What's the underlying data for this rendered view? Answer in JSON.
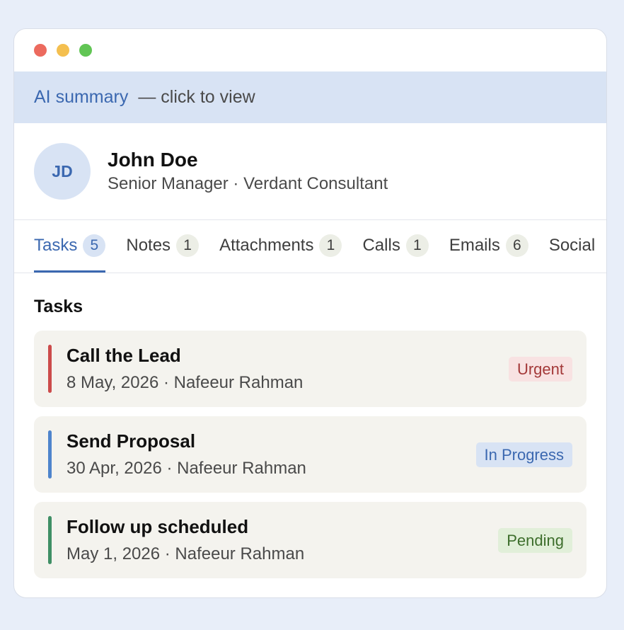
{
  "ai_summary": {
    "link": "AI summary",
    "hint": "— click to view"
  },
  "profile": {
    "initials": "JD",
    "name": "John Doe",
    "role": "Senior Manager · Verdant Consultant"
  },
  "tabs": [
    {
      "label": "Tasks",
      "count": "5",
      "active": true
    },
    {
      "label": "Notes",
      "count": "1"
    },
    {
      "label": "Attachments",
      "count": "1"
    },
    {
      "label": "Calls",
      "count": "1"
    },
    {
      "label": "Emails",
      "count": "6"
    },
    {
      "label": "Social",
      "count": ""
    }
  ],
  "section_title": "Tasks",
  "tasks": [
    {
      "title": "Call the Lead",
      "meta": "8 May, 2026 · Nafeeur Rahman",
      "status": "Urgent",
      "stripe_color": "#cc4b4b",
      "badge_bg": "#f8e2e2",
      "badge_color": "#a33838"
    },
    {
      "title": "Send Proposal",
      "meta": "30 Apr, 2026 · Nafeeur Rahman",
      "status": "In Progress",
      "stripe_color": "#4e84cc",
      "badge_bg": "#d8e3f4",
      "badge_color": "#3b68b0"
    },
    {
      "title": "Follow up scheduled",
      "meta": "May 1, 2026 · Nafeeur Rahman",
      "status": "Pending",
      "stripe_color": "#3f8f65",
      "badge_bg": "#e1efd9",
      "badge_color": "#3d6e2c"
    }
  ]
}
